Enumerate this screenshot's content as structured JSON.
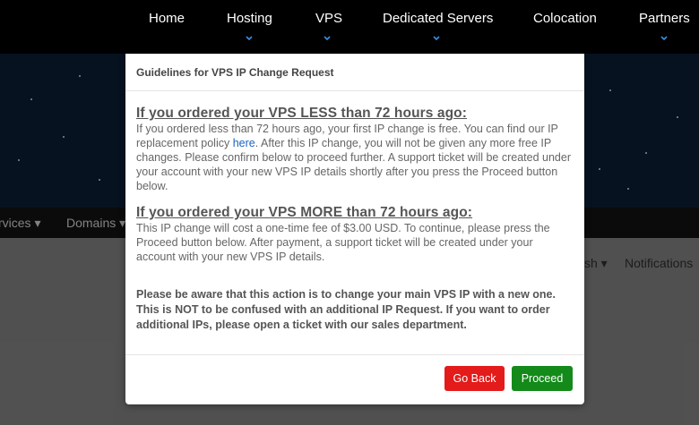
{
  "topnav": {
    "items": [
      "Home",
      "Hosting",
      "VPS",
      "Dedicated Servers",
      "Colocation",
      "Partners"
    ]
  },
  "subnav": {
    "items": [
      "rvices",
      "Domains"
    ]
  },
  "content_menu": {
    "items": [
      "sh",
      "Notifications"
    ]
  },
  "modal": {
    "title": "Guidelines for VPS IP Change Request",
    "section1": {
      "heading": "If you ordered your VPS LESS than 72 hours ago:",
      "text_before_link": "If you ordered less than 72 hours ago, your first IP change is free. You can find our IP replacement policy ",
      "link": "here",
      "text_after_link": ". After this IP change, you will not be given any more free IP changes. Please confirm below to proceed further. A support ticket will be created under your account with your new VPS IP details shortly after you press the Proceed button below."
    },
    "section2": {
      "heading": "If you ordered your VPS MORE than 72 hours ago:",
      "text": "This IP change will cost a one-time fee of $3.00 USD. To continue, please press the Proceed button below. After payment, a support ticket will be created under your account with your new VPS IP details."
    },
    "note": "Please be aware that this action is to change your main VPS IP with a new one. This is NOT to be confused with an additional IP Request. If you want to order additional IPs, please open a ticket with our sales department.",
    "buttons": {
      "back": "Go Back",
      "proceed": "Proceed"
    }
  },
  "colors": {
    "go_back": "#e31b1b",
    "proceed": "#138a19",
    "link": "#1a63c4",
    "caret": "#3b8fe0"
  }
}
